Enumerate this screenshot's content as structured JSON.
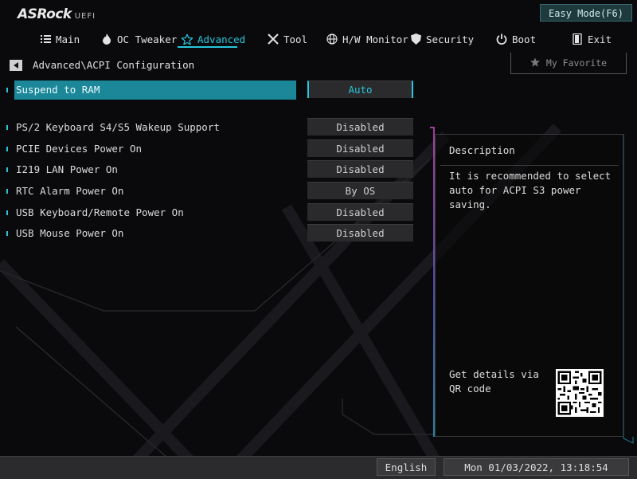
{
  "header": {
    "logo_main": "ASRock",
    "logo_sub": "UEFI",
    "easy_mode_label": "Easy Mode(F6)"
  },
  "nav": {
    "items": [
      {
        "label": "Main",
        "icon": "list-icon"
      },
      {
        "label": "OC Tweaker",
        "icon": "flame-icon"
      },
      {
        "label": "Advanced",
        "icon": "star-icon",
        "active": true
      },
      {
        "label": "Tool",
        "icon": "tools-icon"
      },
      {
        "label": "H/W Monitor",
        "icon": "globe-icon"
      },
      {
        "label": "Security",
        "icon": "shield-icon"
      },
      {
        "label": "Boot",
        "icon": "power-icon"
      },
      {
        "label": "Exit",
        "icon": "exit-icon"
      }
    ]
  },
  "breadcrumb": "Advanced\\ACPI Configuration",
  "favorite_label": "My Favorite",
  "settings": [
    {
      "label": "Suspend to RAM",
      "value": "Auto",
      "selected": true
    },
    {
      "label": "PS/2 Keyboard S4/S5 Wakeup Support",
      "value": "Disabled"
    },
    {
      "label": "PCIE Devices Power On",
      "value": "Disabled"
    },
    {
      "label": "I219 LAN Power On",
      "value": "Disabled"
    },
    {
      "label": "RTC Alarm Power On",
      "value": "By OS"
    },
    {
      "label": "USB Keyboard/Remote Power On",
      "value": "Disabled"
    },
    {
      "label": "USB Mouse Power On",
      "value": "Disabled"
    }
  ],
  "description": {
    "title": "Description",
    "text": "It is recommended to select auto for ACPI S3 power saving.",
    "qr_text": "Get details via QR code"
  },
  "footer": {
    "language": "English",
    "datetime": "Mon 01/03/2022, 13:18:54"
  },
  "colors": {
    "accent": "#27c6dc",
    "selected_row": "#1b8798",
    "background": "#0a0a0c"
  }
}
